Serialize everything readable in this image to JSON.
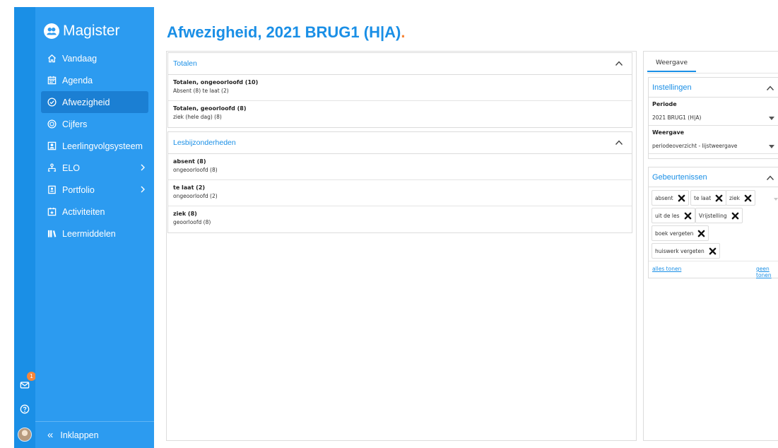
{
  "app": {
    "brand": "Magister",
    "accent": "#1a8fe6",
    "sidebar_bg": "#2c9bf0",
    "orange": "#f6863a"
  },
  "rail": {
    "badge": "1",
    "icons": [
      "mail-icon",
      "help-icon",
      "avatar"
    ]
  },
  "sidebar": {
    "items": [
      {
        "label": "Vandaag",
        "icon": "home-icon"
      },
      {
        "label": "Agenda",
        "icon": "calendar-icon"
      },
      {
        "label": "Afwezigheid",
        "icon": "check-circle-icon",
        "active": true
      },
      {
        "label": "Cijfers",
        "icon": "grade-icon"
      },
      {
        "label": "Leerlingvolgsysteem",
        "icon": "student-tracking-icon"
      },
      {
        "label": "ELO",
        "icon": "elo-icon",
        "has_submenu": true
      },
      {
        "label": "Portfolio",
        "icon": "portfolio-icon",
        "has_submenu": true
      },
      {
        "label": "Activiteiten",
        "icon": "activities-icon"
      },
      {
        "label": "Leermiddelen",
        "icon": "books-icon"
      }
    ],
    "collapse_label": "Inklappen",
    "collapse_glyph": "«"
  },
  "page": {
    "title": "Afwezigheid, 2021 BRUG1 (H|A)",
    "title_dot": "."
  },
  "main": {
    "totalen": {
      "header": "Totalen",
      "rows": [
        {
          "title": "Totalen, ongeoorloofd (10)",
          "sub": "Absent (8)  te laat (2)"
        },
        {
          "title": "Totalen, geoorloofd (8)",
          "sub": "ziek (hele dag) (8)"
        }
      ]
    },
    "lesbijzonderheden": {
      "header": "Lesbijzonderheden",
      "rows": [
        {
          "title": "absent (8)",
          "sub": "ongeoorloofd (8)"
        },
        {
          "title": "te laat (2)",
          "sub": "ongeoorloofd (2)"
        },
        {
          "title": "ziek (8)",
          "sub": "geoorloofd (8)"
        }
      ]
    }
  },
  "right": {
    "tab": "Weergave",
    "instellingen": {
      "header": "Instellingen",
      "periode_label": "Periode",
      "periode_value": "2021 BRUG1 (H|A)",
      "weergave_label": "Weergave",
      "weergave_value": "periodeoverzicht - lijstweergave"
    },
    "gebeurtenissen": {
      "header": "Gebeurtenissen",
      "chips": [
        "absent",
        "te laat",
        "ziek",
        "uit de les",
        "Vrijstelling",
        "boek vergeten",
        "huiswerk vergeten"
      ],
      "show_all": "alles tonen",
      "show_none": "geen tonen"
    }
  }
}
